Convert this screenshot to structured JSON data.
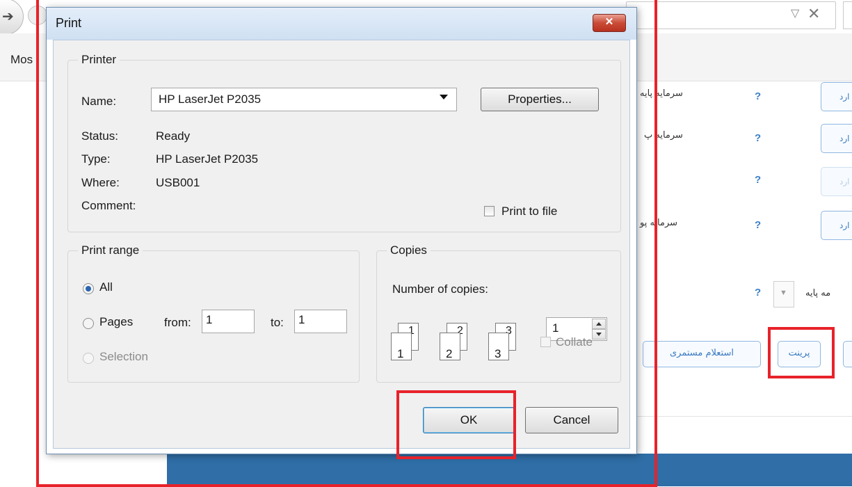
{
  "background": {
    "menu_label": "Mos",
    "rows": [
      {
        "label": "سرمایه پایه",
        "button": "ارد"
      },
      {
        "label": "سرمایه پ",
        "button": "ارد"
      },
      {
        "label": "",
        "button": "ارد"
      },
      {
        "label": "سرمایه پو",
        "button": "ارد"
      }
    ],
    "select_label": "مه پایه",
    "help_mark": "?",
    "print_button": "پرینت",
    "inquiry_button": "استعلام مستمری"
  },
  "dialog": {
    "title": "Print",
    "close_glyph": "✕",
    "printer": {
      "legend": "Printer",
      "name_label": "Name:",
      "name_value": "HP LaserJet P2035",
      "properties_button": "Properties...",
      "status_label": "Status:",
      "status_value": "Ready",
      "type_label": "Type:",
      "type_value": "HP LaserJet P2035",
      "where_label": "Where:",
      "where_value": "USB001",
      "comment_label": "Comment:",
      "comment_value": "",
      "print_to_file_label": "Print to file"
    },
    "print_range": {
      "legend": "Print range",
      "all_label": "All",
      "pages_label": "Pages",
      "from_label": "from:",
      "from_value": "1",
      "to_label": "to:",
      "to_value": "1",
      "selection_label": "Selection"
    },
    "copies": {
      "legend": "Copies",
      "number_label": "Number of copies:",
      "number_value": "1",
      "collate_label": "Collate",
      "page_numbers": [
        "1",
        "2",
        "3"
      ]
    },
    "ok_button": "OK",
    "cancel_button": "Cancel"
  },
  "colors": {
    "highlight": "#e8222a",
    "footer": "#2f6ea6",
    "link_blue": "#3a79c0"
  }
}
